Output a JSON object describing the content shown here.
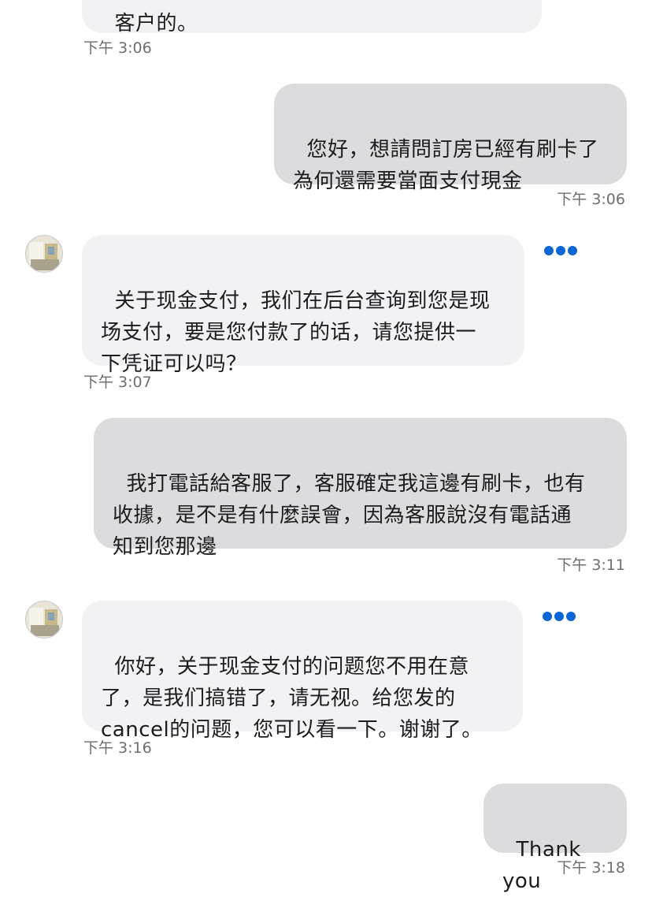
{
  "messages": [
    {
      "text": "客户的。",
      "time": "下午 3:06"
    },
    {
      "text": "您好，想請問訂房已經有刷卡了\n為何還需要當面支付現金",
      "time": "下午 3:06"
    },
    {
      "text": "关于现金支付，我们在后台查询到您是现\n场支付，要是您付款了的话，请您提供一\n下凭证可以吗？",
      "time": "下午 3:07"
    },
    {
      "text": "我打電話給客服了，客服確定我這邊有刷卡，也有\n收據，是不是有什麼誤會，因為客服說沒有電話通\n知到您那邊",
      "time": "下午 3:11"
    },
    {
      "text": "你好，关于现金支付的问题您不用在意\n了，是我们搞错了，请无视。给您发的\ncancel的问题，您可以看一下。谢谢了。",
      "time": "下午 3:16"
    },
    {
      "text": "Thank you",
      "time": "下午 3:18"
    }
  ],
  "icons": {
    "more": "more-options-icon",
    "avatar": "hotel-room-avatar"
  },
  "colors": {
    "incoming_bubble": "#f2f2f4",
    "outgoing_bubble": "#dcdcde",
    "timestamp": "#6e6e73",
    "accent": "#0a66d6"
  }
}
